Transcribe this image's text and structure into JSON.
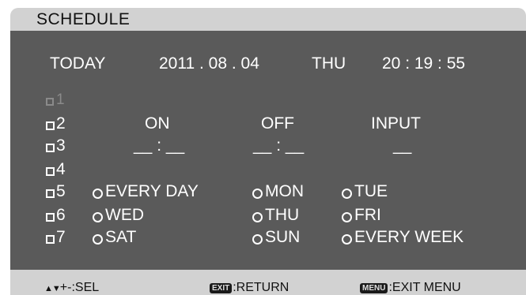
{
  "title": "SCHEDULE",
  "today": {
    "label": "TODAY",
    "date": "2011 . 08 . 04",
    "weekday": "THU",
    "time": "20 : 19 : 55"
  },
  "slots": [
    "1",
    "2",
    "3",
    "4",
    "5",
    "6",
    "7"
  ],
  "columns": {
    "on": "ON",
    "off": "OFF",
    "input": "INPUT"
  },
  "values": {
    "on": "__ : __",
    "off": "__ : __",
    "input": "__"
  },
  "days": {
    "every_day": "EVERY DAY",
    "mon": "MON",
    "tue": "TUE",
    "wed": "WED",
    "thu": "THU",
    "fri": "FRI",
    "sat": "SAT",
    "sun": "SUN",
    "every_week": "EVERY WEEK"
  },
  "footer": {
    "sel_arrows": "▲▼",
    "sel_text": "+-:SEL",
    "exit_key": "EXIT",
    "exit_text": ":RETURN",
    "menu_key": "MENU",
    "menu_text": ":EXIT MENU"
  }
}
